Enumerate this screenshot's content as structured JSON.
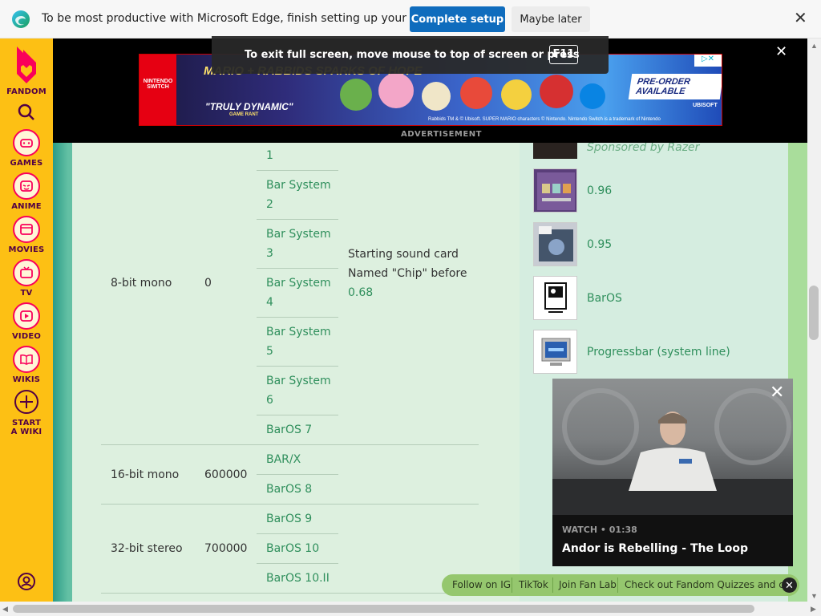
{
  "edge_bar": {
    "message": "To be most productive with Microsoft Edge, finish setting up your browser.",
    "complete_label": "Complete setup",
    "later_label": "Maybe later",
    "close_glyph": "✕"
  },
  "fullscreen_toast": {
    "text": "To exit full screen, move mouse to top of screen or press",
    "key": "F11"
  },
  "ad": {
    "headline": "MARIO + RABBIDS SPARKS OF HOPE",
    "quote": "\"TRULY DYNAMIC\"",
    "quote_source": "GAME RANT",
    "preorder": "PRE-ORDER AVAILABLE",
    "switch_label": "NINTENDO SWITCH",
    "fine_print": "Rabbids TM & © Ubisoft. SUPER MARIO characters © Nintendo. Nintendo Switch is a trademark of Nintendo",
    "publisher": "UBISOFT",
    "label": "ADVERTISEMENT",
    "close_glyph": "✕"
  },
  "fandom_rail": {
    "items": [
      {
        "label": "FANDOM",
        "icon": "fandom-logo-icon"
      },
      {
        "label": "",
        "icon": "search-icon"
      },
      {
        "label": "GAMES",
        "icon": "games-icon"
      },
      {
        "label": "ANIME",
        "icon": "anime-icon"
      },
      {
        "label": "MOVIES",
        "icon": "movies-icon"
      },
      {
        "label": "TV",
        "icon": "tv-icon"
      },
      {
        "label": "VIDEO",
        "icon": "video-icon"
      },
      {
        "label": "WIKIS",
        "icon": "wikis-icon"
      },
      {
        "label": "START A WIKI",
        "icon": "plus-icon"
      },
      {
        "label": "",
        "icon": "user-icon"
      }
    ]
  },
  "table": {
    "rows": [
      {
        "sound": "8-bit mono",
        "price": "0",
        "versions": [
          "1",
          "Bar System 2",
          "Bar System 3",
          "Bar System 4",
          "Bar System 5",
          "Bar System 6",
          "BarOS 7"
        ],
        "note_text": "Starting sound card Named \"Chip\" before",
        "note_link": "0.68"
      },
      {
        "sound": "16-bit mono",
        "price": "600000",
        "versions": [
          "BAR/X",
          "BarOS 8"
        ]
      },
      {
        "sound": "32-bit stereo",
        "price": "700000",
        "versions": [
          "BarOS 9",
          "BarOS 10",
          "BarOS 10.II"
        ]
      }
    ]
  },
  "sidebar_list": {
    "sponsored": "Sponsored by Razer",
    "items": [
      "0.96",
      "0.95",
      "BarOS",
      "Progressbar (system line)"
    ]
  },
  "video": {
    "meta": "WATCH • 01:38",
    "title": "Andor is Rebelling - The Loop",
    "close_glyph": "✕"
  },
  "social_bar": {
    "items": [
      "Follow on IG",
      "TikTok",
      "Join Fan Lab",
      "Check out Fandom Quizzes and cha"
    ],
    "close_glyph": "✕"
  },
  "colors": {
    "edge_blue": "#0f6cbd",
    "fandom_yellow": "#fdc014",
    "fandom_pink": "#fa005a",
    "link_green": "#2f8f5c"
  }
}
